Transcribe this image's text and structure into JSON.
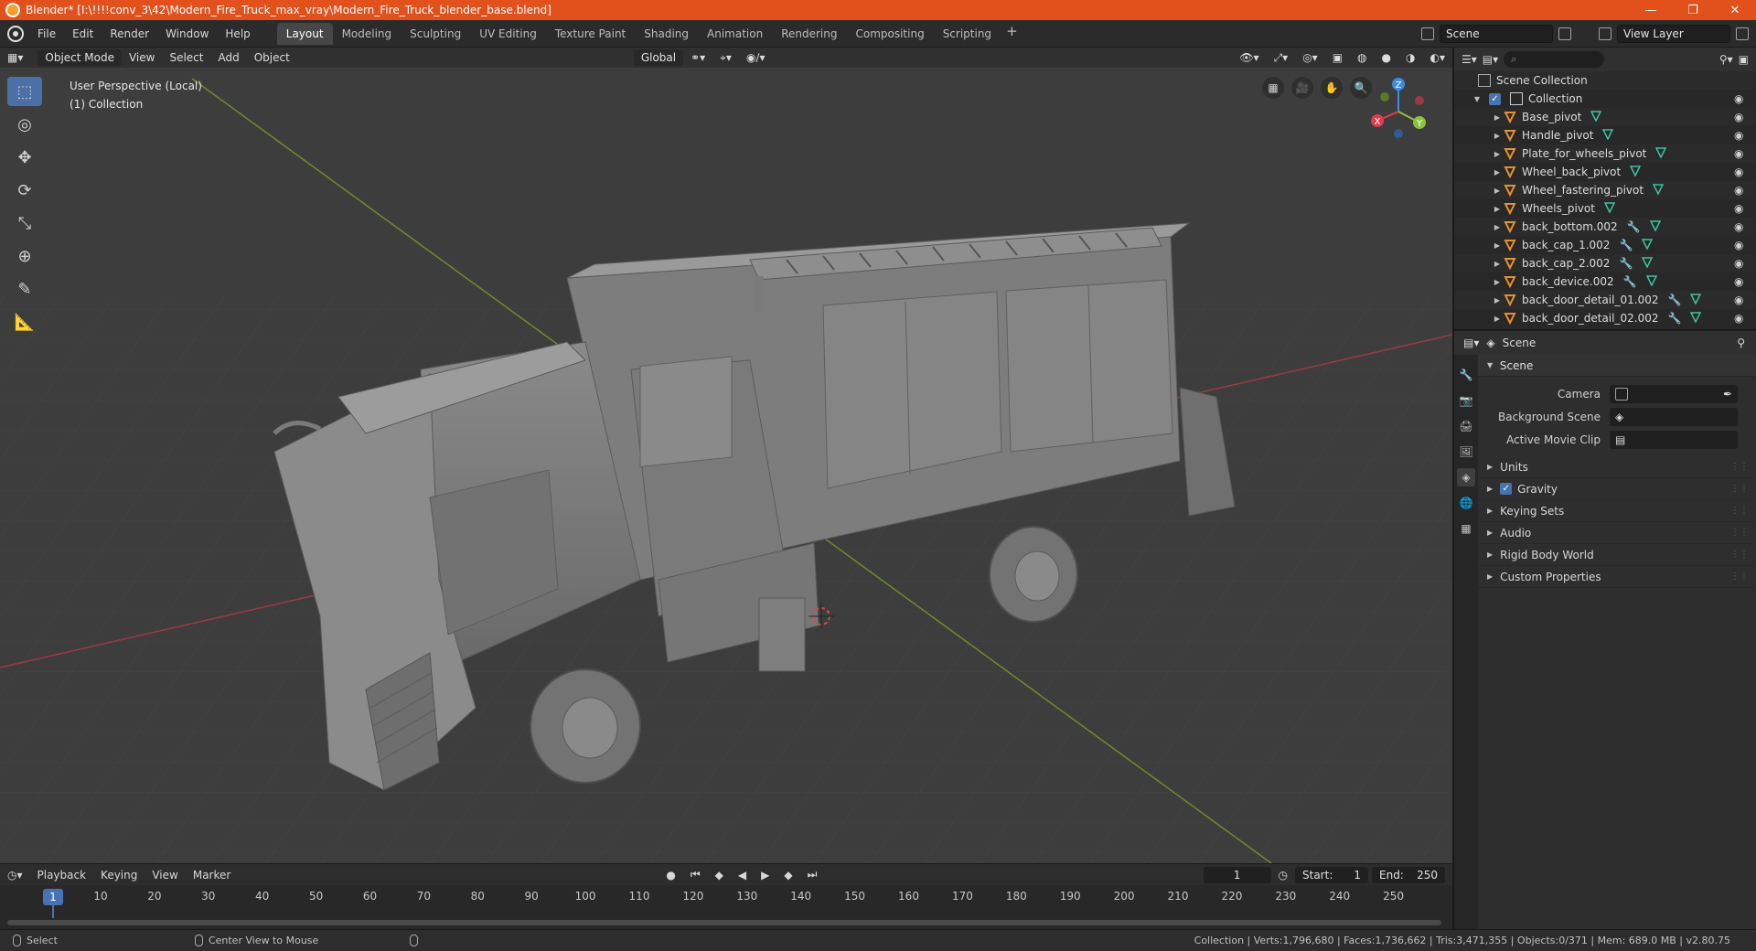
{
  "window": {
    "title": "Blender* [I:\\!!!!conv_3\\42\\Modern_Fire_Truck_max_vray\\Modern_Fire_Truck_blender_base.blend]",
    "minimize": "—",
    "maximize": "❐",
    "close": "✕"
  },
  "menubar": {
    "items": [
      "File",
      "Edit",
      "Render",
      "Window",
      "Help"
    ],
    "workspaces": [
      "Layout",
      "Modeling",
      "Sculpting",
      "UV Editing",
      "Texture Paint",
      "Shading",
      "Animation",
      "Rendering",
      "Compositing",
      "Scripting"
    ],
    "active_workspace": "Layout",
    "add": "+",
    "scene": "Scene",
    "view_layer": "View Layer"
  },
  "viewport_header": {
    "mode": "Object Mode",
    "menus": [
      "View",
      "Select",
      "Add",
      "Object"
    ],
    "transform": "Global"
  },
  "viewport": {
    "info_line1": "User Perspective (Local)",
    "info_line2": "(1) Collection",
    "gizmo_axes": [
      "X",
      "Y",
      "Z"
    ],
    "colors": {
      "x": "#e03c50",
      "y": "#8bc33a",
      "z": "#3d8be0"
    }
  },
  "timeline": {
    "menus": [
      "Playback",
      "Keying",
      "View",
      "Marker"
    ],
    "current_frame": "1",
    "start_label": "Start:",
    "start": "1",
    "end_label": "End:",
    "end": "250",
    "ruler": [
      "10",
      "20",
      "30",
      "40",
      "50",
      "60",
      "70",
      "80",
      "90",
      "100",
      "110",
      "120",
      "130",
      "140",
      "150",
      "160",
      "170",
      "180",
      "190",
      "200",
      "210",
      "220",
      "230",
      "240",
      "250"
    ],
    "cursor": "1"
  },
  "statusbar": {
    "select": "Select",
    "center": "Center View to Mouse",
    "stats": "Collection | Verts:1,796,680 | Faces:1,736,662 | Tris:3,471,355 | Objects:0/371 | Mem: 689.0 MB | v2.80.75"
  },
  "outliner": {
    "scene_collection": "Scene Collection",
    "collection": "Collection",
    "items": [
      {
        "name": "Base_pivot",
        "modifier": false
      },
      {
        "name": "Handle_pivot",
        "modifier": false
      },
      {
        "name": "Plate_for_wheels_pivot",
        "modifier": false
      },
      {
        "name": "Wheel_back_pivot",
        "modifier": false
      },
      {
        "name": "Wheel_fastering_pivot",
        "modifier": false
      },
      {
        "name": "Wheels_pivot",
        "modifier": false
      },
      {
        "name": "back_bottom.002",
        "modifier": true
      },
      {
        "name": "back_cap_1.002",
        "modifier": true
      },
      {
        "name": "back_cap_2.002",
        "modifier": true
      },
      {
        "name": "back_device.002",
        "modifier": true
      },
      {
        "name": "back_door_detail_01.002",
        "modifier": true
      },
      {
        "name": "back_door_detail_02.002",
        "modifier": true
      }
    ]
  },
  "properties": {
    "context": "Scene",
    "panel": "Scene",
    "camera_label": "Camera",
    "background_label": "Background Scene",
    "clip_label": "Active Movie Clip",
    "subpanels": [
      "Units",
      "Gravity",
      "Keying Sets",
      "Audio",
      "Rigid Body World",
      "Custom Properties"
    ],
    "gravity_checked": true
  }
}
